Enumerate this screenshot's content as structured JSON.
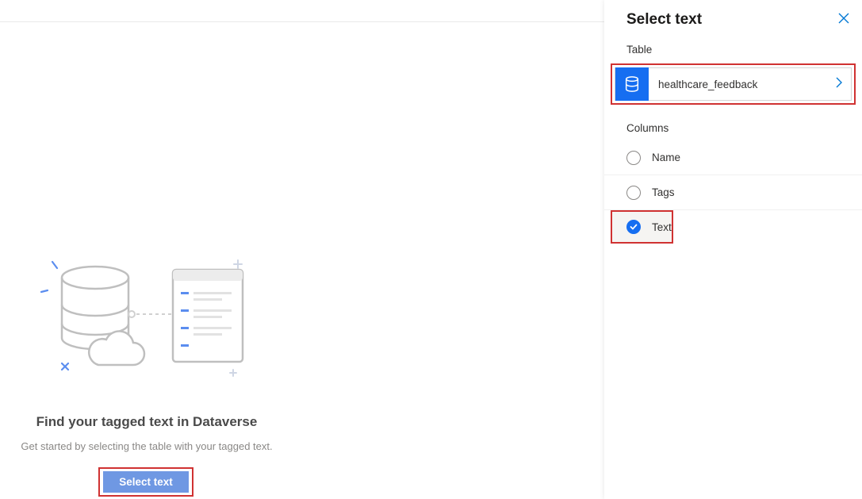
{
  "main": {
    "heading": "Find your tagged text in Dataverse",
    "subtext": "Get started by selecting the table with your tagged text.",
    "select_button": "Select text"
  },
  "panel": {
    "title": "Select text",
    "table_section_label": "Table",
    "table_name": "healthcare_feedback",
    "columns_section_label": "Columns",
    "columns": [
      {
        "label": "Name",
        "selected": false
      },
      {
        "label": "Tags",
        "selected": false
      },
      {
        "label": "Text",
        "selected": true
      }
    ]
  },
  "colors": {
    "accent": "#166ef1",
    "link": "#0078d4",
    "highlight_border": "#d03232"
  }
}
